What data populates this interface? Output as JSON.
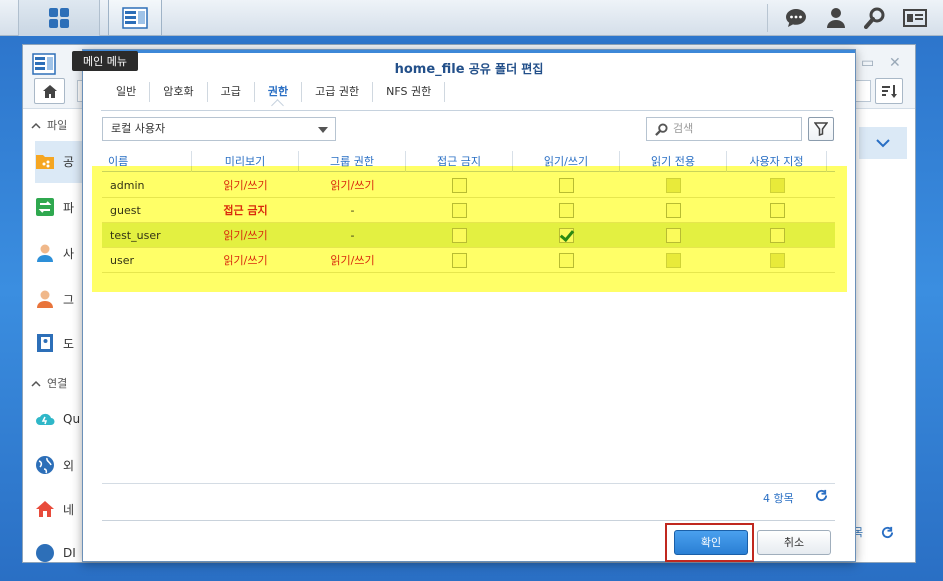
{
  "tooltip": "메인 메뉴",
  "dialog": {
    "title_name": "home_file",
    "title_rest": " 공유 폴더 편집",
    "tabs": [
      "일반",
      "암호화",
      "고급",
      "권한",
      "고급 권한",
      "NFS 권한"
    ],
    "active_tab": "권한",
    "user_select": "로컬 사용자",
    "search_placeholder": "검색",
    "columns": [
      "이름",
      "미리보기",
      "그룹 권한",
      "접근 금지",
      "읽기/쓰기",
      "읽기 전용",
      "사용자 지정"
    ],
    "rows": [
      {
        "name": "admin",
        "preview": "읽기/쓰기",
        "group": "읽기/쓰기",
        "deny": "off",
        "rw": "off",
        "ro": "disabled",
        "custom": "disabled"
      },
      {
        "name": "guest",
        "preview": "접근 금지",
        "group": "-",
        "deny": "off",
        "rw": "off",
        "ro": "off",
        "custom": "off"
      },
      {
        "name": "test_user",
        "preview": "읽기/쓰기",
        "group": "-",
        "deny": "off",
        "rw": "on",
        "ro": "off",
        "custom": "off"
      },
      {
        "name": "user",
        "preview": "읽기/쓰기",
        "group": "읽기/쓰기",
        "deny": "off",
        "rw": "off",
        "ro": "disabled",
        "custom": "disabled"
      }
    ],
    "count": "4 항목",
    "ok_label": "확인",
    "cancel_label": "취소"
  },
  "background": {
    "sections": [
      "파일",
      "연결"
    ],
    "items": [
      "공",
      "파",
      "사",
      "그",
      "도",
      "Qu",
      "외",
      "네",
      "DI"
    ],
    "bottom_text": "목"
  },
  "colors": {
    "accent": "#2a6fc4",
    "highlight": "#ffff3c",
    "ok_frame": "#c0281f",
    "deny_red": "#d92b1e"
  }
}
